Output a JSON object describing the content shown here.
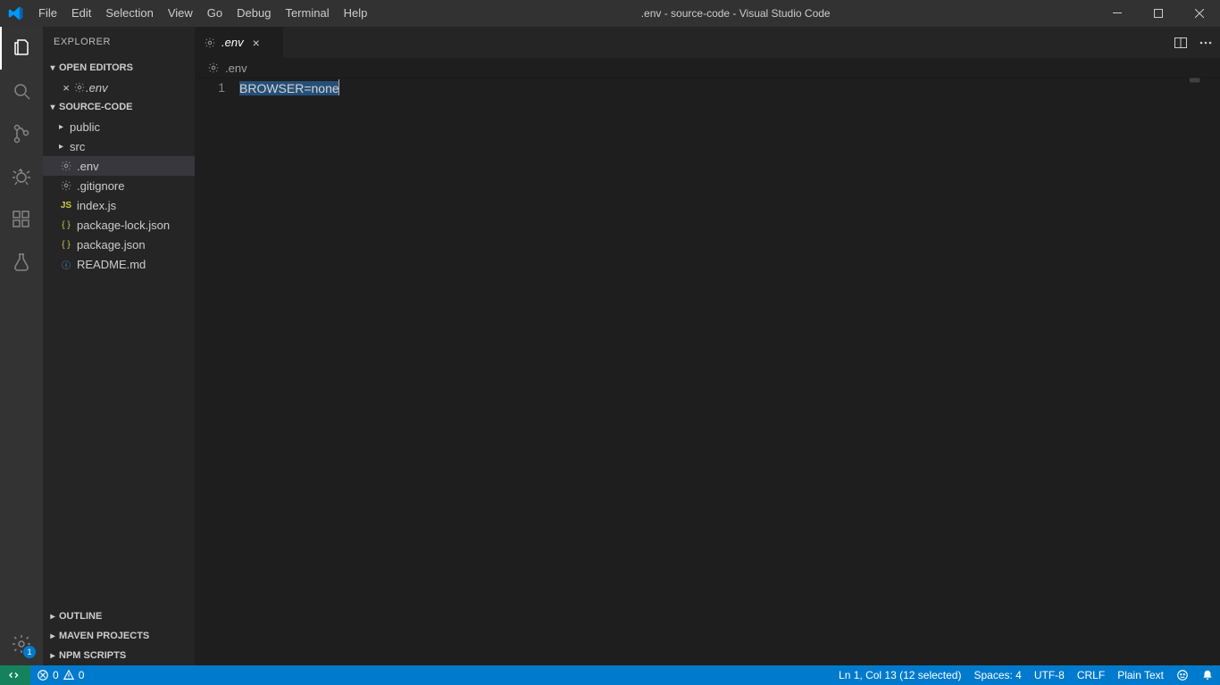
{
  "window": {
    "title": ".env - source-code - Visual Studio Code"
  },
  "menubar": [
    "File",
    "Edit",
    "Selection",
    "View",
    "Go",
    "Debug",
    "Terminal",
    "Help"
  ],
  "explorer": {
    "title": "EXPLORER",
    "sections": {
      "openEditors": {
        "label": "OPEN EDITORS",
        "items": [
          {
            "icon": "gear",
            "name": ".env"
          }
        ]
      },
      "project": {
        "label": "SOURCE-CODE",
        "tree": [
          {
            "type": "folder",
            "name": "public"
          },
          {
            "type": "folder",
            "name": "src"
          },
          {
            "type": "file",
            "icon": "gear",
            "name": ".env",
            "selected": true
          },
          {
            "type": "file",
            "icon": "gear",
            "name": ".gitignore"
          },
          {
            "type": "file",
            "icon": "js",
            "name": "index.js"
          },
          {
            "type": "file",
            "icon": "json",
            "name": "package-lock.json"
          },
          {
            "type": "file",
            "icon": "json",
            "name": "package.json"
          },
          {
            "type": "file",
            "icon": "info",
            "name": "README.md"
          }
        ]
      },
      "outline": {
        "label": "OUTLINE"
      },
      "maven": {
        "label": "MAVEN PROJECTS"
      },
      "npm": {
        "label": "NPM SCRIPTS"
      }
    }
  },
  "tab": {
    "icon": "gear",
    "name": ".env"
  },
  "breadcrumb": {
    "icon": "gear",
    "name": ".env"
  },
  "editor": {
    "lines": [
      {
        "n": "1",
        "text": "BROWSER=none"
      }
    ]
  },
  "status": {
    "errors": "0",
    "warnings": "0",
    "cursor": "Ln 1, Col 13 (12 selected)",
    "spaces": "Spaces: 4",
    "encoding": "UTF-8",
    "eol": "CRLF",
    "lang": "Plain Text"
  },
  "activity": {
    "settingsBadge": "1"
  }
}
